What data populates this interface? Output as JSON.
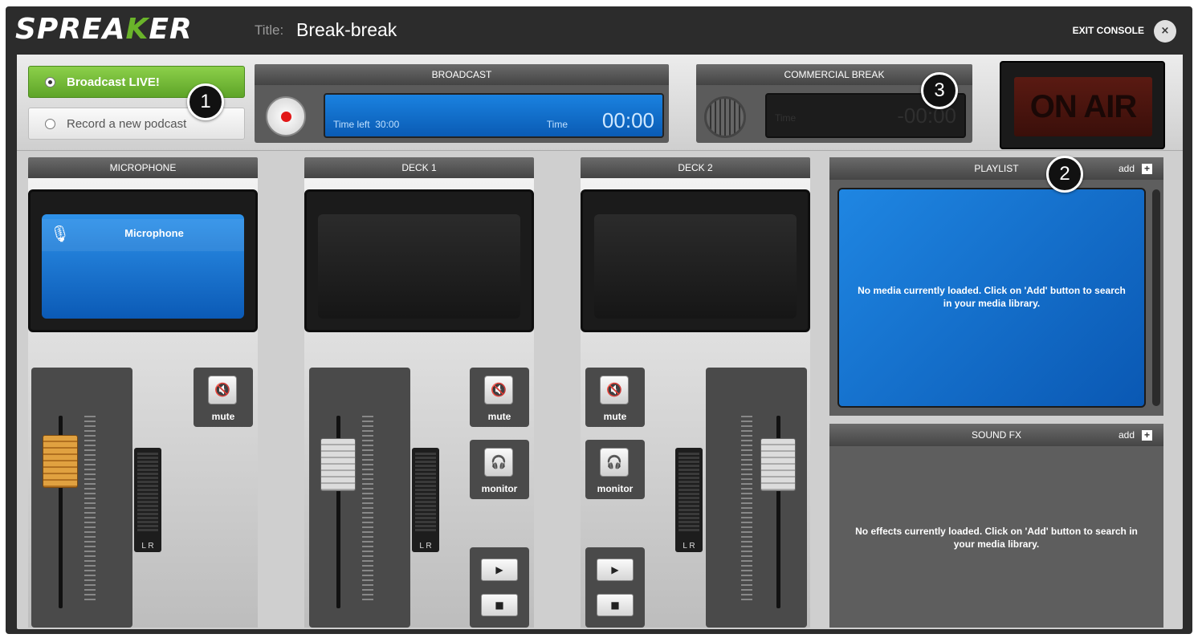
{
  "header": {
    "logo": "SPREAKER",
    "title_label": "Title:",
    "title_value": "Break-break",
    "exit_label": "EXIT CONSOLE",
    "exit_icon": "×"
  },
  "mode": {
    "options": [
      {
        "label": "Broadcast LIVE!",
        "selected": true
      },
      {
        "label": "Record a new podcast",
        "selected": false
      }
    ]
  },
  "broadcast": {
    "header": "BROADCAST",
    "time_left_label": "Time left",
    "time_left_value": "30:00",
    "time_label": "Time",
    "time_value": "00:00"
  },
  "commercial_break": {
    "header": "COMMERCIAL BREAK",
    "time_label": "Time",
    "time_value": "-00:00"
  },
  "on_air": "ON AIR",
  "channels": {
    "microphone": {
      "header": "MICROPHONE",
      "source_label": "Microphone",
      "mute_label": "mute",
      "vu": "L R"
    },
    "deck1": {
      "header": "DECK 1",
      "mute_label": "mute",
      "monitor_label": "monitor",
      "vu": "L R"
    },
    "deck2": {
      "header": "DECK 2",
      "mute_label": "mute",
      "monitor_label": "monitor",
      "vu": "L R"
    }
  },
  "playlist": {
    "header": "PLAYLIST",
    "add_label": "add",
    "empty_message": "No media currently loaded. Click on 'Add' button to search in your media library."
  },
  "sound_fx": {
    "header": "SOUND FX",
    "add_label": "add",
    "empty_message": "No effects currently loaded. Click on 'Add' button to search in your media library."
  },
  "callouts": [
    "1",
    "2",
    "3"
  ],
  "icons": {
    "play": "▶",
    "stop": "■",
    "mute": "🔇",
    "monitor": "🎧",
    "add": "+"
  },
  "colors": {
    "accent_green": "#6ab42a",
    "display_blue": "#1a82e0",
    "record_red": "#e21818"
  }
}
